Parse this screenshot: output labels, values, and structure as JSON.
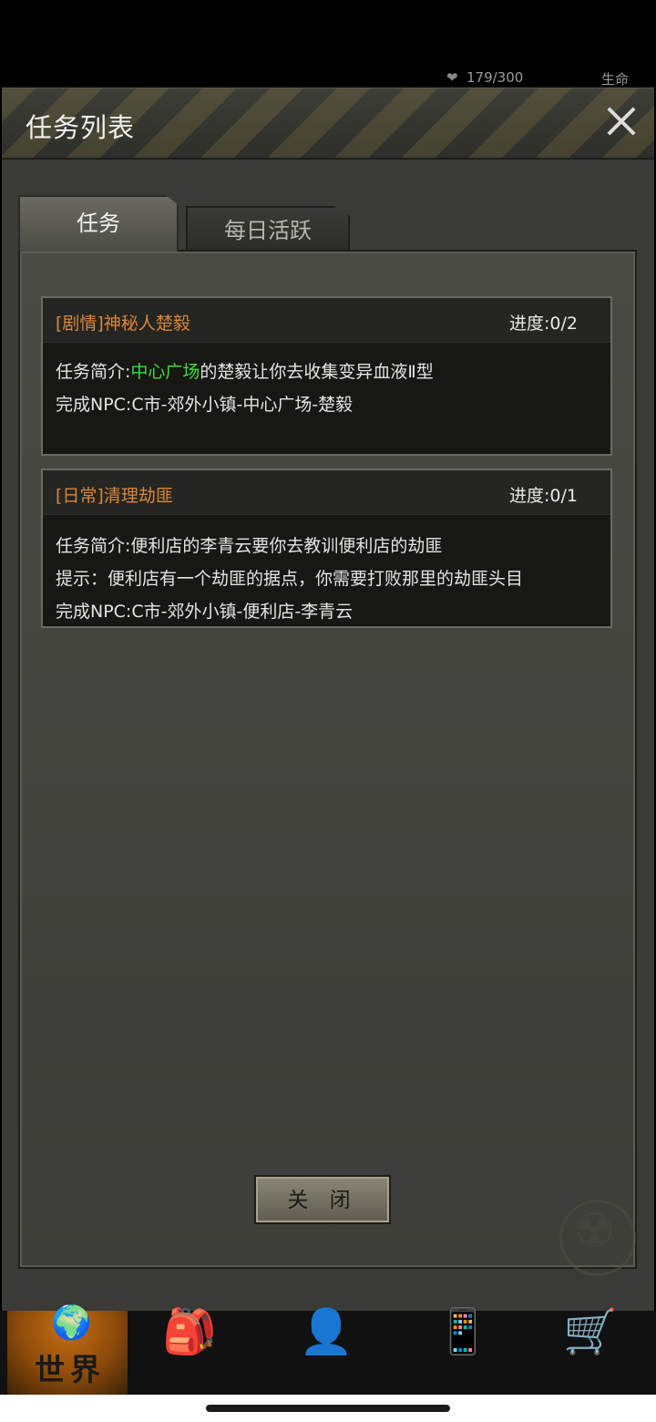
{
  "status": {
    "hp_text": "179/300",
    "life_label": "生命"
  },
  "modal": {
    "title": "任务列表",
    "tabs": [
      {
        "label": "任务",
        "active": true
      },
      {
        "label": "每日活跃",
        "active": false
      }
    ],
    "quests": [
      {
        "title": "[剧情]神秘人楚毅",
        "progress": "进度:0/2",
        "lines": [
          {
            "prefix": "任务简介:",
            "highlight": "中心广场",
            "suffix": "的楚毅让你去收集变异血液Ⅱ型"
          },
          {
            "text": "完成NPC:C市-郊外小镇-中心广场-楚毅"
          }
        ]
      },
      {
        "title": "[日常]清理劫匪",
        "progress": "进度:0/1",
        "lines": [
          {
            "text": "任务简介:便利店的李青云要你去教训便利店的劫匪"
          },
          {
            "text": "提示：便利店有一个劫匪的据点，你需要打败那里的劫匪头目"
          },
          {
            "text": "完成NPC:C市-郊外小镇-便利店-李青云"
          }
        ]
      }
    ],
    "close_button": "关 闭"
  },
  "bottom_nav": {
    "items": [
      {
        "label": "世界",
        "icon": "globe-icon",
        "active": true
      },
      {
        "icon": "backpack-icon"
      },
      {
        "icon": "head-gear-icon"
      },
      {
        "icon": "phone-icon"
      },
      {
        "icon": "cart-icon"
      }
    ]
  },
  "colors": {
    "quest_title": "#d8873a",
    "highlight": "#3fdc3f",
    "nav_active": "#c87012"
  }
}
